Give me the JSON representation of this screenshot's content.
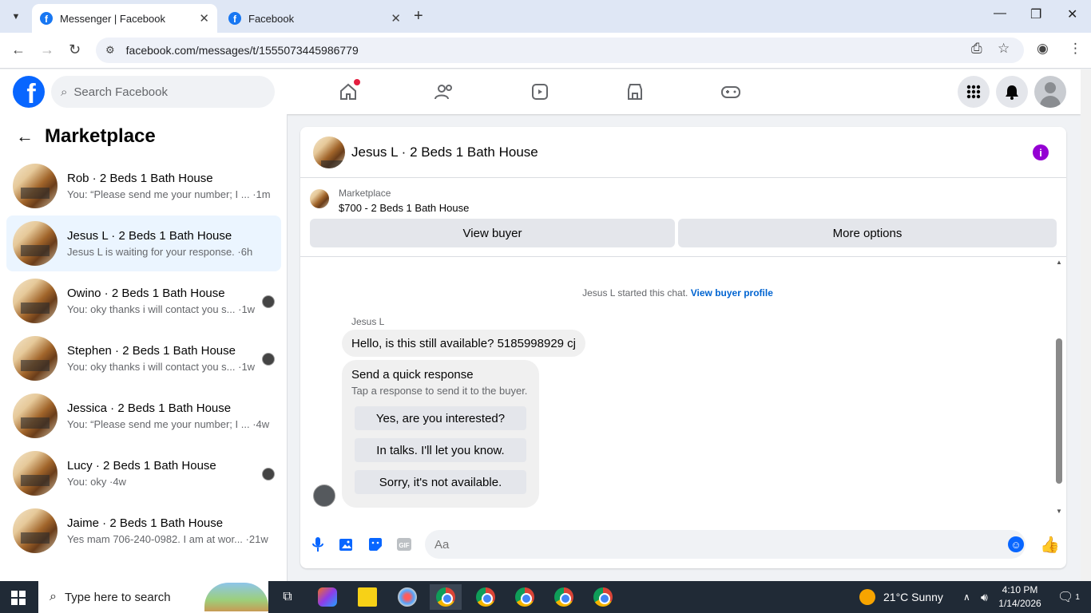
{
  "browser": {
    "tabs": [
      {
        "title": "Messenger | Facebook",
        "active": true
      },
      {
        "title": "Facebook",
        "active": false
      }
    ],
    "url": "facebook.com/messages/t/1555073445986779"
  },
  "header": {
    "logo": "f",
    "search_placeholder": "Search Facebook"
  },
  "sidebar": {
    "title": "Marketplace",
    "conversations": [
      {
        "name": "Rob · 2 Beds 1 Bath House",
        "preview": "You: “Please send me your number; I ... ·1m",
        "selected": false,
        "has_avatar": false
      },
      {
        "name": "Jesus L · 2 Beds 1 Bath House",
        "preview": "Jesus L is waiting for your response. ·6h",
        "selected": true,
        "has_avatar": false
      },
      {
        "name": "Owino · 2 Beds 1 Bath House",
        "preview": "You: oky thanks i will contact you s... ·1w",
        "selected": false,
        "has_avatar": true
      },
      {
        "name": "Stephen · 2 Beds 1 Bath House",
        "preview": "You: oky thanks i will contact you s... ·1w",
        "selected": false,
        "has_avatar": true
      },
      {
        "name": "Jessica · 2 Beds 1 Bath House",
        "preview": "You: “Please send me your number; I ... ·4w",
        "selected": false,
        "has_avatar": false
      },
      {
        "name": "Lucy · 2 Beds 1 Bath House",
        "preview": "You: oky ·4w",
        "selected": false,
        "has_avatar": true
      },
      {
        "name": "Jaime · 2 Beds 1 Bath House",
        "preview": "Yes mam 706-240-0982. I am at wor... ·21w",
        "selected": false,
        "has_avatar": false
      }
    ]
  },
  "chat": {
    "title": "Jesus L · 2 Beds 1 Bath House",
    "marketplace_label": "Marketplace",
    "listing": "$700 - 2 Beds 1 Bath House",
    "view_buyer": "View buyer",
    "more_options": "More options",
    "started_text": "Jesus L started this chat.",
    "view_profile": "View buyer profile",
    "sender": "Jesus L",
    "message": "Hello, is this still available? 5185998929 cj",
    "quick_title": "Send a quick response",
    "quick_sub": "Tap a response to send it to the buyer.",
    "quick_options": [
      "Yes, are you interested?",
      "In talks. I'll let you know.",
      "Sorry, it's not available."
    ],
    "composer_placeholder": "Aa"
  },
  "taskbar": {
    "search_placeholder": "Type here to search",
    "weather": "21°C  Sunny",
    "time": "4:10 PM",
    "date": "1/14/2026",
    "notif_count": "1"
  },
  "colors": {
    "fb_blue": "#0866ff",
    "selected_bg": "#ebf5ff",
    "info_purple": "#9400d3"
  }
}
